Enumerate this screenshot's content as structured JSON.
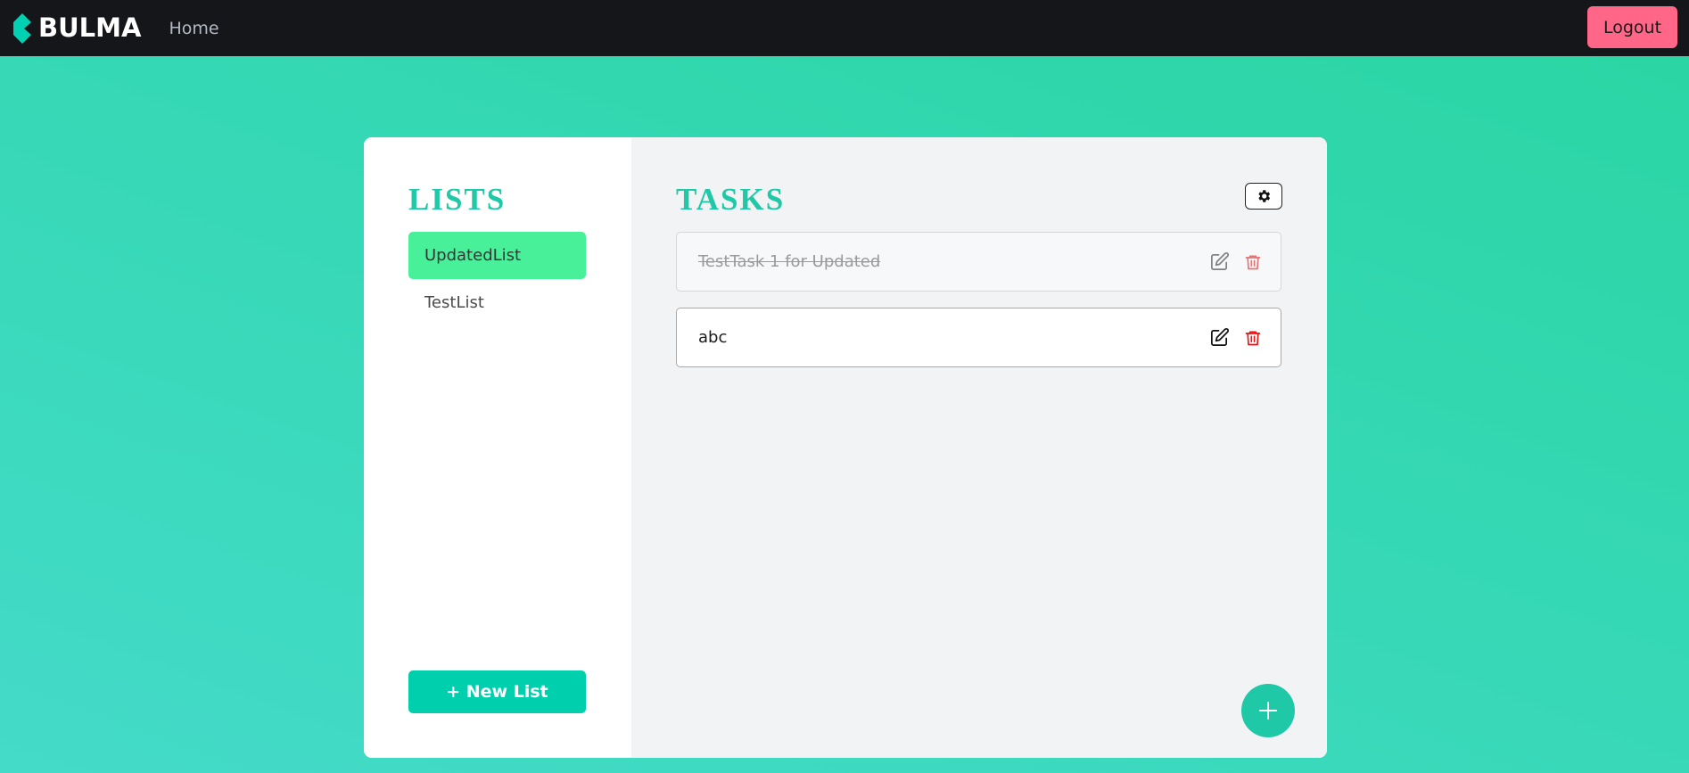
{
  "navbar": {
    "brand": "BULMA",
    "home_label": "Home",
    "logout_label": "Logout"
  },
  "lists": {
    "title": "LISTS",
    "items": [
      {
        "label": "UpdatedList",
        "active": true
      },
      {
        "label": "TestList",
        "active": false
      }
    ],
    "new_list_label": "+ New List"
  },
  "tasks": {
    "title": "TASKS",
    "items": [
      {
        "label": "TestTask 1 for Updated",
        "completed": true
      },
      {
        "label": "abc",
        "completed": false
      }
    ]
  },
  "icons": {
    "brand": "bulma-logo-icon",
    "settings": "gear-icon",
    "edit": "pencil-square-icon",
    "delete": "trash-icon",
    "add": "plus-icon"
  },
  "colors": {
    "navbar_bg": "#14161a",
    "logout_bg": "#ff6687",
    "accent": "#1fc8a6",
    "active_list": "#48f09a",
    "new_list_bg": "#00cfae",
    "delete_red": "#e01818"
  }
}
